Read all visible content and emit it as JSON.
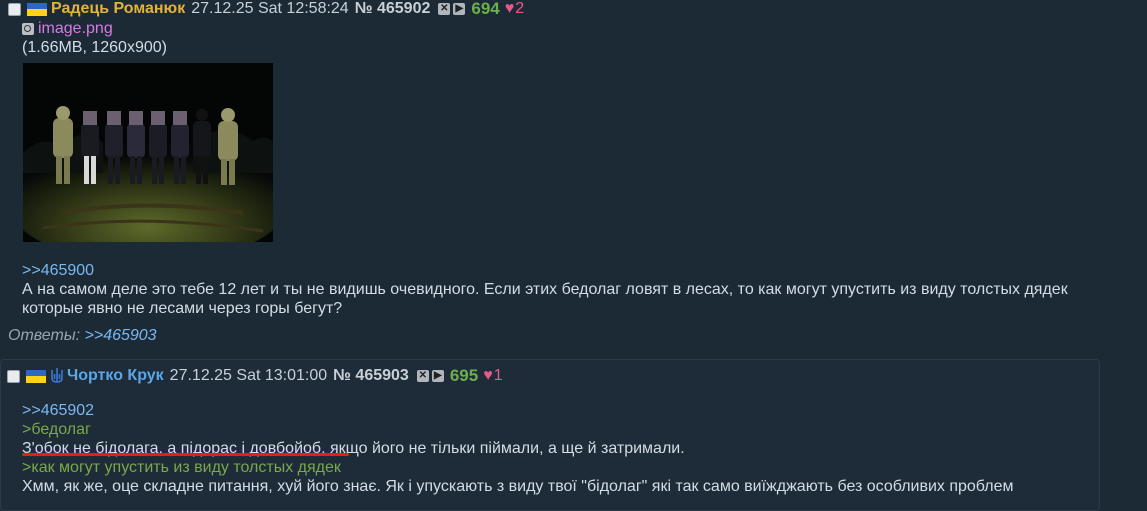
{
  "posts": [
    {
      "name": "Радець Романюк",
      "datetime": "27.12.25 Sat 12:58:24",
      "number": "№ 465902",
      "count": "694",
      "likes": "2",
      "file": {
        "name": "image.png",
        "info": "(1.66MB, 1260x900)"
      },
      "reply_link": ">>465900",
      "lines": [
        "А на самом деле это тебе 12 лет и ты не видишь очевидного. Если этих бедолаг ловят в лесах, то как могут упустить из виду толстых дядек",
        "которые явно не лесами через горы бегут?"
      ],
      "answers_label": "Ответы:",
      "answers_link": ">>465903"
    },
    {
      "name": "Чортко Крук",
      "datetime": "27.12.25 Sat 13:01:00",
      "number": "№ 465903",
      "count": "695",
      "likes": "1",
      "reply_link": ">>465902",
      "quote1": ">бедолаг",
      "line1": "З'обок не бідолага, а підорас і довбойоб, якщо його не тільки піймали, а ще й затримали.",
      "quote2": ">как могут упустить из виду толстых дядек",
      "line2": "Хмм, як же, оце складне питання, хуй його знає. Як і упускають з виду твої \"бідолаг\" які так само виїжджають без особливих проблем"
    }
  ],
  "colors": {
    "background": "#1c2a36",
    "name1": "#e3b23c",
    "name2": "#5aa6e8",
    "reply_link": "#7bb7f0",
    "quote": "#7aa84a",
    "count": "#6bb04a",
    "likes": "#e55a8a",
    "file_link": "#d77ae6",
    "underline": "#e0201a"
  }
}
